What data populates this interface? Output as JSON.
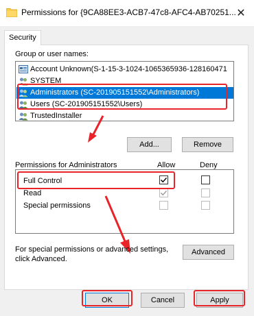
{
  "window": {
    "title": "Permissions for {9CA88EE3-ACB7-47c8-AFC4-AB70251...",
    "icons": {
      "title": "folder-icon",
      "close": "close-icon"
    }
  },
  "tabs": [
    {
      "label": "Security"
    }
  ],
  "group_list": {
    "label": "Group or user names:",
    "items": [
      {
        "label": "Account Unknown(S-1-15-3-1024-1065365936-128160471",
        "icon": "unknown-account-icon"
      },
      {
        "label": "SYSTEM",
        "icon": "users-icon"
      },
      {
        "label": "Administrators (SC-201905151552\\Administrators)",
        "icon": "users-icon",
        "selected": true
      },
      {
        "label": "Users (SC-201905151552\\Users)",
        "icon": "users-icon"
      },
      {
        "label": "TrustedInstaller",
        "icon": "users-icon"
      }
    ],
    "add_label": "Add...",
    "remove_label": "Remove"
  },
  "permissions": {
    "header": "Permissions for Administrators",
    "allow_label": "Allow",
    "deny_label": "Deny",
    "rows": [
      {
        "name": "Full Control",
        "allow": true,
        "deny": false
      },
      {
        "name": "Read",
        "allow": true,
        "deny": false
      },
      {
        "name": "Special permissions",
        "allow": false,
        "deny": false
      }
    ]
  },
  "advanced": {
    "text_line1": "For special permissions or advanced settings,",
    "text_line2": "click Advanced.",
    "button_label": "Advanced"
  },
  "footer": {
    "ok_label": "OK",
    "cancel_label": "Cancel",
    "apply_label": "Apply"
  },
  "colors": {
    "selection": "#0078d7",
    "annotation": "#e8232a"
  }
}
